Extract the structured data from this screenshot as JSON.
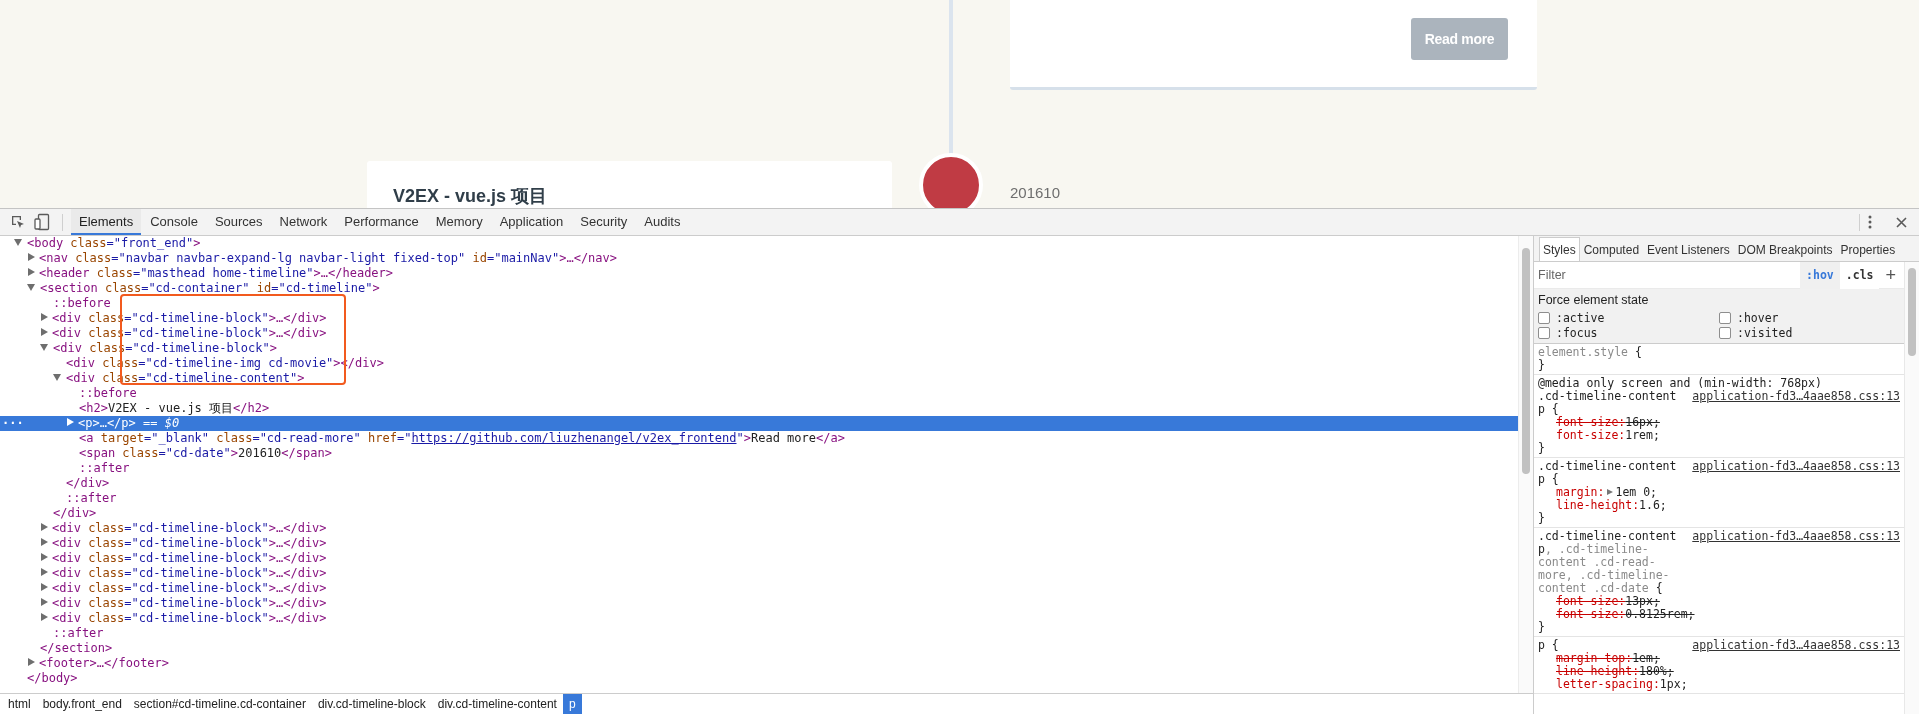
{
  "page": {
    "read_more": "Read more",
    "card_title": "V2EX - vue.js 项目",
    "date": "201610"
  },
  "devtools": {
    "tabs": [
      {
        "label": "Elements",
        "selected": true
      },
      {
        "label": "Console",
        "selected": false
      },
      {
        "label": "Sources",
        "selected": false
      },
      {
        "label": "Network",
        "selected": false
      },
      {
        "label": "Performance",
        "selected": false
      },
      {
        "label": "Memory",
        "selected": false
      },
      {
        "label": "Application",
        "selected": false
      },
      {
        "label": "Security",
        "selected": false
      },
      {
        "label": "Audits",
        "selected": false
      }
    ]
  },
  "tree": [
    {
      "kind": "element",
      "expanded": true,
      "selected": false,
      "parts": [
        {
          "kind": "tag",
          "t": "<body"
        },
        {
          "kind": "attr",
          "t": " class"
        },
        {
          "kind": "val",
          "t": "=\"front_end\""
        },
        {
          "kind": "tag",
          "t": ">"
        }
      ],
      "close": [
        {
          "kind": "tag",
          "t": "</body>"
        }
      ],
      "children": [
        {
          "kind": "element",
          "expanded": false,
          "selected": false,
          "parts": [
            {
              "kind": "tag",
              "t": "<nav"
            },
            {
              "kind": "attr",
              "t": " class"
            },
            {
              "kind": "val",
              "t": "=\"navbar navbar-expand-lg navbar-light fixed-top\""
            },
            {
              "kind": "attr",
              "t": " id"
            },
            {
              "kind": "val",
              "t": "=\"mainNav\""
            },
            {
              "kind": "tag",
              "t": ">…</nav>"
            }
          ]
        },
        {
          "kind": "element",
          "expanded": false,
          "selected": false,
          "parts": [
            {
              "kind": "tag",
              "t": "<header"
            },
            {
              "kind": "attr",
              "t": " class"
            },
            {
              "kind": "val",
              "t": "=\"masthead home-timeline\""
            },
            {
              "kind": "tag",
              "t": ">…</header>"
            }
          ]
        },
        {
          "kind": "element",
          "expanded": true,
          "selected": false,
          "parts": [
            {
              "kind": "tag",
              "t": "<section"
            },
            {
              "kind": "attr",
              "t": " class"
            },
            {
              "kind": "val",
              "t": "=\"cd-container\""
            },
            {
              "kind": "attr",
              "t": " id"
            },
            {
              "kind": "val",
              "t": "=\"cd-timeline\""
            },
            {
              "kind": "tag",
              "t": ">"
            }
          ],
          "close": [
            {
              "kind": "tag",
              "t": "</section>"
            }
          ],
          "children": [
            {
              "kind": "pseudo",
              "selected": false,
              "parts": [
                {
                  "kind": "pseudo",
                  "t": "::before"
                }
              ]
            },
            {
              "kind": "element",
              "expanded": false,
              "selected": false,
              "parts": [
                {
                  "kind": "tag",
                  "t": "<div"
                },
                {
                  "kind": "attr",
                  "t": " class"
                },
                {
                  "kind": "val",
                  "t": "=\"cd-timeline-block\""
                },
                {
                  "kind": "tag",
                  "t": ">…</div>"
                }
              ]
            },
            {
              "kind": "element",
              "expanded": false,
              "selected": false,
              "parts": [
                {
                  "kind": "tag",
                  "t": "<div"
                },
                {
                  "kind": "attr",
                  "t": " class"
                },
                {
                  "kind": "val",
                  "t": "=\"cd-timeline-block\""
                },
                {
                  "kind": "tag",
                  "t": ">…</div>"
                }
              ]
            },
            {
              "kind": "element",
              "expanded": true,
              "selected": false,
              "parts": [
                {
                  "kind": "tag",
                  "t": "<div"
                },
                {
                  "kind": "attr",
                  "t": " class"
                },
                {
                  "kind": "val",
                  "t": "=\"cd-timeline-block\""
                },
                {
                  "kind": "tag",
                  "t": ">"
                }
              ],
              "close": [
                {
                  "kind": "tag",
                  "t": "</div>"
                }
              ],
              "children": [
                {
                  "kind": "leaf",
                  "selected": false,
                  "parts": [
                    {
                      "kind": "tag",
                      "t": "<div"
                    },
                    {
                      "kind": "attr",
                      "t": " class"
                    },
                    {
                      "kind": "val",
                      "t": "=\"cd-timeline-img cd-movie\""
                    },
                    {
                      "kind": "tag",
                      "t": "></div>"
                    }
                  ]
                },
                {
                  "kind": "element",
                  "expanded": true,
                  "selected": false,
                  "parts": [
                    {
                      "kind": "tag",
                      "t": "<div"
                    },
                    {
                      "kind": "attr",
                      "t": " class"
                    },
                    {
                      "kind": "val",
                      "t": "=\"cd-timeline-content\""
                    },
                    {
                      "kind": "tag",
                      "t": ">"
                    }
                  ],
                  "close": [
                    {
                      "kind": "tag",
                      "t": "</div>"
                    }
                  ],
                  "children": [
                    {
                      "kind": "pseudo",
                      "selected": false,
                      "parts": [
                        {
                          "kind": "pseudo",
                          "t": "::before"
                        }
                      ]
                    },
                    {
                      "kind": "leaf",
                      "selected": false,
                      "parts": [
                        {
                          "kind": "tag",
                          "t": "<h2>"
                        },
                        {
                          "kind": "text",
                          "t": "V2EX - vue.js 项目"
                        },
                        {
                          "kind": "tag",
                          "t": "</h2>"
                        }
                      ]
                    },
                    {
                      "kind": "element",
                      "expanded": false,
                      "selected": true,
                      "gutter": "...",
                      "parts": [
                        {
                          "kind": "tag",
                          "t": "<p>…</p>"
                        },
                        {
                          "kind": "dollar",
                          "t": " == $0"
                        }
                      ]
                    },
                    {
                      "kind": "leaf",
                      "selected": false,
                      "parts": [
                        {
                          "kind": "tag",
                          "t": "<a"
                        },
                        {
                          "kind": "attr",
                          "t": " target"
                        },
                        {
                          "kind": "val",
                          "t": "=\"_blank\""
                        },
                        {
                          "kind": "attr",
                          "t": " class"
                        },
                        {
                          "kind": "val",
                          "t": "=\"cd-read-more\""
                        },
                        {
                          "kind": "attr",
                          "t": " href"
                        },
                        {
                          "kind": "val",
                          "t": "=\""
                        },
                        {
                          "kind": "link",
                          "t": "https://github.com/liuzhenangel/v2ex_frontend"
                        },
                        {
                          "kind": "val",
                          "t": "\""
                        },
                        {
                          "kind": "tag",
                          "t": ">"
                        },
                        {
                          "kind": "text",
                          "t": "Read more"
                        },
                        {
                          "kind": "tag",
                          "t": "</a>"
                        }
                      ]
                    },
                    {
                      "kind": "leaf",
                      "selected": false,
                      "parts": [
                        {
                          "kind": "tag",
                          "t": "<span"
                        },
                        {
                          "kind": "attr",
                          "t": " class"
                        },
                        {
                          "kind": "val",
                          "t": "=\"cd-date\""
                        },
                        {
                          "kind": "tag",
                          "t": ">"
                        },
                        {
                          "kind": "text",
                          "t": "201610"
                        },
                        {
                          "kind": "tag",
                          "t": "</span>"
                        }
                      ]
                    },
                    {
                      "kind": "pseudo",
                      "selected": false,
                      "parts": [
                        {
                          "kind": "pseudo",
                          "t": "::after"
                        }
                      ]
                    }
                  ]
                },
                {
                  "kind": "pseudo",
                  "selected": false,
                  "parts": [
                    {
                      "kind": "pseudo",
                      "t": "::after"
                    }
                  ]
                }
              ]
            },
            {
              "kind": "element",
              "expanded": false,
              "selected": false,
              "parts": [
                {
                  "kind": "tag",
                  "t": "<div"
                },
                {
                  "kind": "attr",
                  "t": " class"
                },
                {
                  "kind": "val",
                  "t": "=\"cd-timeline-block\""
                },
                {
                  "kind": "tag",
                  "t": ">…</div>"
                }
              ]
            },
            {
              "kind": "element",
              "expanded": false,
              "selected": false,
              "parts": [
                {
                  "kind": "tag",
                  "t": "<div"
                },
                {
                  "kind": "attr",
                  "t": " class"
                },
                {
                  "kind": "val",
                  "t": "=\"cd-timeline-block\""
                },
                {
                  "kind": "tag",
                  "t": ">…</div>"
                }
              ]
            },
            {
              "kind": "element",
              "expanded": false,
              "selected": false,
              "parts": [
                {
                  "kind": "tag",
                  "t": "<div"
                },
                {
                  "kind": "attr",
                  "t": " class"
                },
                {
                  "kind": "val",
                  "t": "=\"cd-timeline-block\""
                },
                {
                  "kind": "tag",
                  "t": ">…</div>"
                }
              ]
            },
            {
              "kind": "element",
              "expanded": false,
              "selected": false,
              "parts": [
                {
                  "kind": "tag",
                  "t": "<div"
                },
                {
                  "kind": "attr",
                  "t": " class"
                },
                {
                  "kind": "val",
                  "t": "=\"cd-timeline-block\""
                },
                {
                  "kind": "tag",
                  "t": ">…</div>"
                }
              ]
            },
            {
              "kind": "element",
              "expanded": false,
              "selected": false,
              "parts": [
                {
                  "kind": "tag",
                  "t": "<div"
                },
                {
                  "kind": "attr",
                  "t": " class"
                },
                {
                  "kind": "val",
                  "t": "=\"cd-timeline-block\""
                },
                {
                  "kind": "tag",
                  "t": ">…</div>"
                }
              ]
            },
            {
              "kind": "element",
              "expanded": false,
              "selected": false,
              "parts": [
                {
                  "kind": "tag",
                  "t": "<div"
                },
                {
                  "kind": "attr",
                  "t": " class"
                },
                {
                  "kind": "val",
                  "t": "=\"cd-timeline-block\""
                },
                {
                  "kind": "tag",
                  "t": ">…</div>"
                }
              ]
            },
            {
              "kind": "element",
              "expanded": false,
              "selected": false,
              "parts": [
                {
                  "kind": "tag",
                  "t": "<div"
                },
                {
                  "kind": "attr",
                  "t": " class"
                },
                {
                  "kind": "val",
                  "t": "=\"cd-timeline-block\""
                },
                {
                  "kind": "tag",
                  "t": ">…</div>"
                }
              ]
            },
            {
              "kind": "pseudo",
              "selected": false,
              "parts": [
                {
                  "kind": "pseudo",
                  "t": "::after"
                }
              ]
            }
          ]
        },
        {
          "kind": "element",
          "expanded": false,
          "selected": false,
          "parts": [
            {
              "kind": "tag",
              "t": "<footer>…</footer>"
            }
          ]
        }
      ]
    }
  ],
  "breadcrumbs": [
    {
      "label": "html",
      "selected": false
    },
    {
      "label": "body.front_end",
      "selected": false
    },
    {
      "label": "section#cd-timeline.cd-container",
      "selected": false
    },
    {
      "label": "div.cd-timeline-block",
      "selected": false
    },
    {
      "label": "div.cd-timeline-content",
      "selected": false
    },
    {
      "label": "p",
      "selected": true
    }
  ],
  "styles": {
    "tabs": [
      {
        "label": "Styles",
        "selected": true
      },
      {
        "label": "Computed",
        "selected": false
      },
      {
        "label": "Event Listeners",
        "selected": false
      },
      {
        "label": "DOM Breakpoints",
        "selected": false
      },
      {
        "label": "Properties",
        "selected": false
      }
    ],
    "filter": {
      "placeholder": "Filter"
    },
    "hov": {
      "label": ":hov",
      "on": true
    },
    "cls": {
      "label": ".cls",
      "on": false
    },
    "add": "+",
    "force_state": {
      "title": "Force element state",
      "states": [
        {
          "label": ":active",
          "checked": false
        },
        {
          "label": ":hover",
          "checked": false
        },
        {
          "label": ":focus",
          "checked": false
        },
        {
          "label": ":visited",
          "checked": false
        }
      ]
    },
    "rules": [
      {
        "selector": [
          {
            "t": "element.style",
            "matched": false
          }
        ],
        "open": " {",
        "close": "}"
      },
      {
        "media": "@media only screen and (min-width: 768px)",
        "source": "application-fd3…4aae858.css:13",
        "selector": [
          {
            "t": ".cd-timeline-content p",
            "matched": true
          }
        ],
        "open": " {",
        "close": "}",
        "props": [
          {
            "name": "font-size:",
            "value": "16px;",
            "overridden": true,
            "expandable": false
          },
          {
            "name": "font-size:",
            "value": "1rem;",
            "overridden": false,
            "expandable": false
          }
        ]
      },
      {
        "source": "application-fd3…4aae858.css:13",
        "selector": [
          {
            "t": ".cd-timeline-content p",
            "matched": true
          }
        ],
        "open": " {",
        "close": "}",
        "props": [
          {
            "name": "margin:",
            "value": "1em 0;",
            "overridden": false,
            "expandable": true
          },
          {
            "name": "line-height:",
            "value": "1.6;",
            "overridden": false,
            "expandable": false
          }
        ]
      },
      {
        "source": "application-fd3…4aae858.css:13",
        "selector": [
          {
            "t": ".cd-timeline-content p",
            "matched": true
          },
          {
            "t": ", .cd-timeline-content .cd-read-more, .cd-timeline-content .cd-date",
            "matched": false
          }
        ],
        "open": " {",
        "close": "}",
        "props": [
          {
            "name": "font-size:",
            "value": "13px;",
            "overridden": true,
            "expandable": false
          },
          {
            "name": "font-size:",
            "value": "0.8125rem;",
            "overridden": true,
            "expandable": false
          }
        ]
      },
      {
        "source": "application-fd3…4aae858.css:13",
        "selector": [
          {
            "t": "p",
            "matched": true
          }
        ],
        "open": " {",
        "props": [
          {
            "name": "margin-top:",
            "value": "1em;",
            "overridden": true,
            "expandable": false
          },
          {
            "name": "line-height:",
            "value": "180%;",
            "overridden": true,
            "expandable": false
          },
          {
            "name": "letter-spacing:",
            "value": "1px;",
            "overridden": false,
            "expandable": false
          }
        ]
      }
    ]
  }
}
